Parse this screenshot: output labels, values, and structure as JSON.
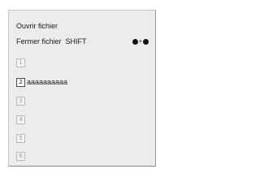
{
  "menu": {
    "open_file": "Ouvrir fichier",
    "close_file": "Fermer fichier",
    "close_shortcut_text": "SHIFT",
    "close_shortcut_plus": "+",
    "shortcut_icons": [
      "dot-icon",
      "dot-icon"
    ],
    "recent": [
      {
        "number": "1",
        "label": "",
        "enabled": false
      },
      {
        "number": "2",
        "label": "aaaaaaaaaa",
        "enabled": true
      },
      {
        "number": "3",
        "label": "",
        "enabled": false
      },
      {
        "number": "4",
        "label": "",
        "enabled": false
      },
      {
        "number": "5",
        "label": "",
        "enabled": false
      },
      {
        "number": "6",
        "label": "",
        "enabled": false
      }
    ]
  },
  "colors": {
    "menu_background": "#ececec",
    "text": "#1a1a1a",
    "disabled_number": "#9c9c9c"
  }
}
